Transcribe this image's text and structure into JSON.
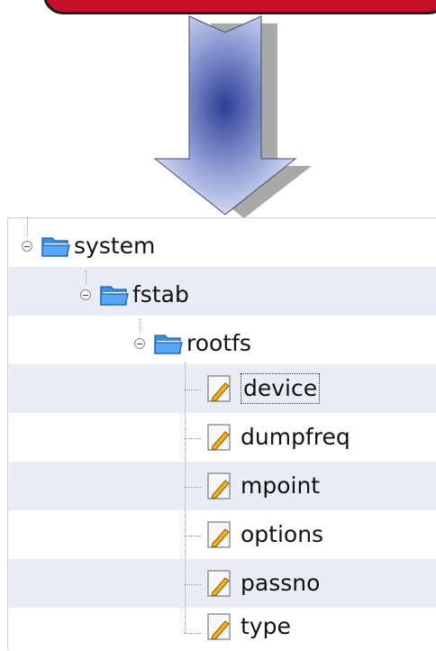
{
  "tree": {
    "root": {
      "label": "system",
      "expanded": true,
      "icon": "folder-icon",
      "children": [
        {
          "label": "fstab",
          "expanded": true,
          "icon": "folder-icon",
          "children": [
            {
              "label": "rootfs",
              "expanded": true,
              "icon": "folder-icon",
              "children": [
                {
                  "label": "device",
                  "icon": "file-edit-icon",
                  "selected": true
                },
                {
                  "label": "dumpfreq",
                  "icon": "file-edit-icon"
                },
                {
                  "label": "mpoint",
                  "icon": "file-edit-icon"
                },
                {
                  "label": "options",
                  "icon": "file-edit-icon"
                },
                {
                  "label": "passno",
                  "icon": "file-edit-icon"
                },
                {
                  "label": "type",
                  "icon": "file-edit-icon"
                }
              ]
            }
          ]
        }
      ]
    }
  },
  "colors": {
    "banner": "#c4102a",
    "row_shade": "#eaedf5",
    "arrow": "#5d6fbf",
    "folder": "#3c8fe6"
  }
}
